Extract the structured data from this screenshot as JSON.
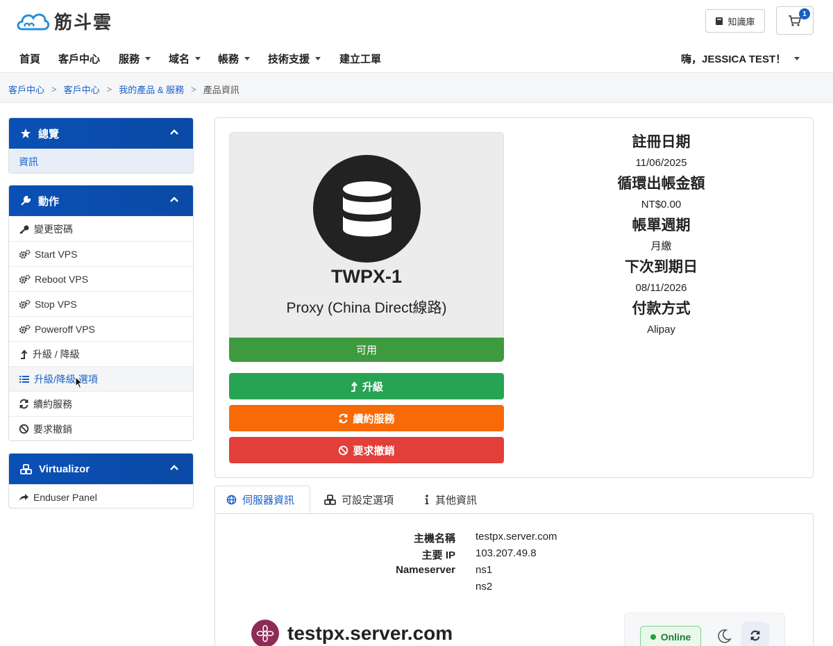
{
  "brand": {
    "name": "筋斗雲"
  },
  "header": {
    "knowledge_base": "知識庫",
    "cart_count": "1"
  },
  "nav": {
    "items": [
      {
        "label": "首頁",
        "dropdown": false
      },
      {
        "label": "客戶中心",
        "dropdown": false
      },
      {
        "label": "服務",
        "dropdown": true
      },
      {
        "label": "域名",
        "dropdown": true
      },
      {
        "label": "帳務",
        "dropdown": true
      },
      {
        "label": "技術支援",
        "dropdown": true
      },
      {
        "label": "建立工單",
        "dropdown": false
      }
    ],
    "user": "嗨，JESSICA TEST！"
  },
  "breadcrumb": [
    "客戶中心",
    "客戶中心",
    "我的產品 & 服務",
    "產品資訊"
  ],
  "sidebar": {
    "overview": {
      "title": "總覽",
      "items": [
        "資訊"
      ]
    },
    "actions": {
      "title": "動作",
      "items": [
        {
          "label": "變更密碼",
          "icon": "key-icon"
        },
        {
          "label": "Start VPS",
          "icon": "gears-icon"
        },
        {
          "label": "Reboot VPS",
          "icon": "gears-icon"
        },
        {
          "label": "Stop VPS",
          "icon": "gears-icon"
        },
        {
          "label": "Poweroff VPS",
          "icon": "gears-icon"
        },
        {
          "label": "升級 / 降級",
          "icon": "level-up-icon"
        },
        {
          "label": "升級/降級 選項",
          "icon": "list-icon"
        },
        {
          "label": "續約服務",
          "icon": "refresh-icon"
        },
        {
          "label": "要求撤銷",
          "icon": "ban-icon"
        }
      ]
    },
    "virtualizor": {
      "title": "Virtualizor",
      "items": [
        "Enduser Panel"
      ]
    }
  },
  "product": {
    "name": "TWPX-1",
    "subtitle": "Proxy (China Direct線路)",
    "status": "可用",
    "buttons": {
      "upgrade": "升級",
      "renew": "續約服務",
      "cancel": "要求撤銷"
    },
    "colors": {
      "status": "#3e9a3e",
      "upgrade": "#26a453",
      "renew": "#f76a05",
      "cancel": "#e23f3a"
    }
  },
  "info": {
    "reg_date_label": "註冊日期",
    "reg_date": "11/06/2025",
    "recurring_label": "循環出帳金額",
    "recurring": "NT$0.00",
    "cycle_label": "帳單週期",
    "cycle": "月繳",
    "next_due_label": "下次到期日",
    "next_due": "08/11/2026",
    "payment_label": "付款方式",
    "payment": "Alipay"
  },
  "tabs": [
    "伺服器資訊",
    "可設定選項",
    "其他資訊"
  ],
  "server": {
    "hostname_label": "主機名稱",
    "hostname": "testpx.server.com",
    "ip_label": "主要 IP",
    "ip": "103.207.49.8",
    "ns_label": "Nameserver",
    "ns1": "ns1",
    "ns2": "ns2",
    "panel_name": "testpx.server.com",
    "online": "Online"
  }
}
